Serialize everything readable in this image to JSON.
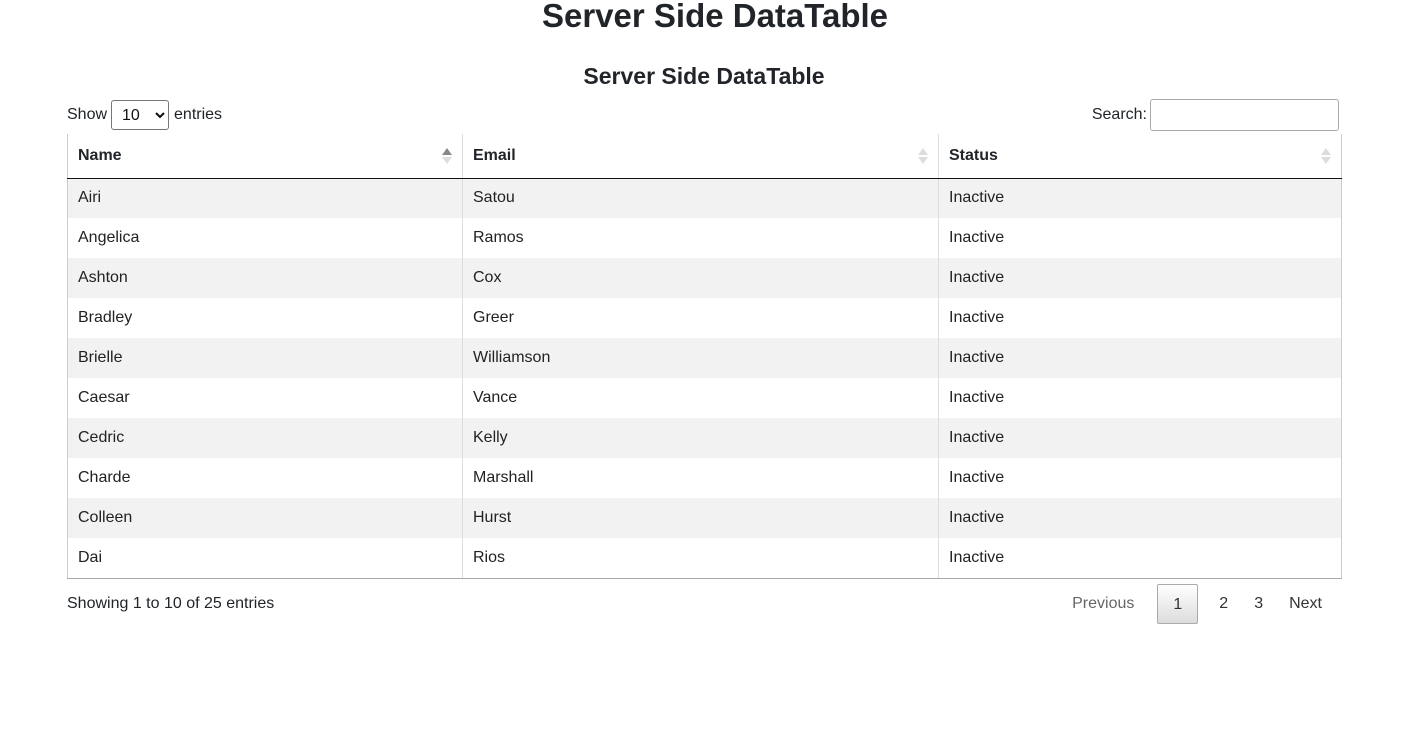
{
  "page": {
    "title": "Server Side DataTable"
  },
  "table_title": "Server Side DataTable",
  "length": {
    "show_label": "Show",
    "selected": "10",
    "entries_label": "entries"
  },
  "search": {
    "label": "Search:",
    "value": ""
  },
  "columns": [
    {
      "label": "Name",
      "sort": "asc"
    },
    {
      "label": "Email",
      "sort": "none"
    },
    {
      "label": "Status",
      "sort": "none"
    }
  ],
  "rows": [
    {
      "name": "Airi",
      "email": "Satou",
      "status": "Inactive"
    },
    {
      "name": "Angelica",
      "email": "Ramos",
      "status": "Inactive"
    },
    {
      "name": "Ashton",
      "email": "Cox",
      "status": "Inactive"
    },
    {
      "name": "Bradley",
      "email": "Greer",
      "status": "Inactive"
    },
    {
      "name": "Brielle",
      "email": "Williamson",
      "status": "Inactive"
    },
    {
      "name": "Caesar",
      "email": "Vance",
      "status": "Inactive"
    },
    {
      "name": "Cedric",
      "email": "Kelly",
      "status": "Inactive"
    },
    {
      "name": "Charde",
      "email": "Marshall",
      "status": "Inactive"
    },
    {
      "name": "Colleen",
      "email": "Hurst",
      "status": "Inactive"
    },
    {
      "name": "Dai",
      "email": "Rios",
      "status": "Inactive"
    }
  ],
  "info": "Showing 1 to 10 of 25 entries",
  "pagination": {
    "previous": "Previous",
    "pages": [
      "1",
      "2",
      "3"
    ],
    "current": "1",
    "next": "Next"
  }
}
